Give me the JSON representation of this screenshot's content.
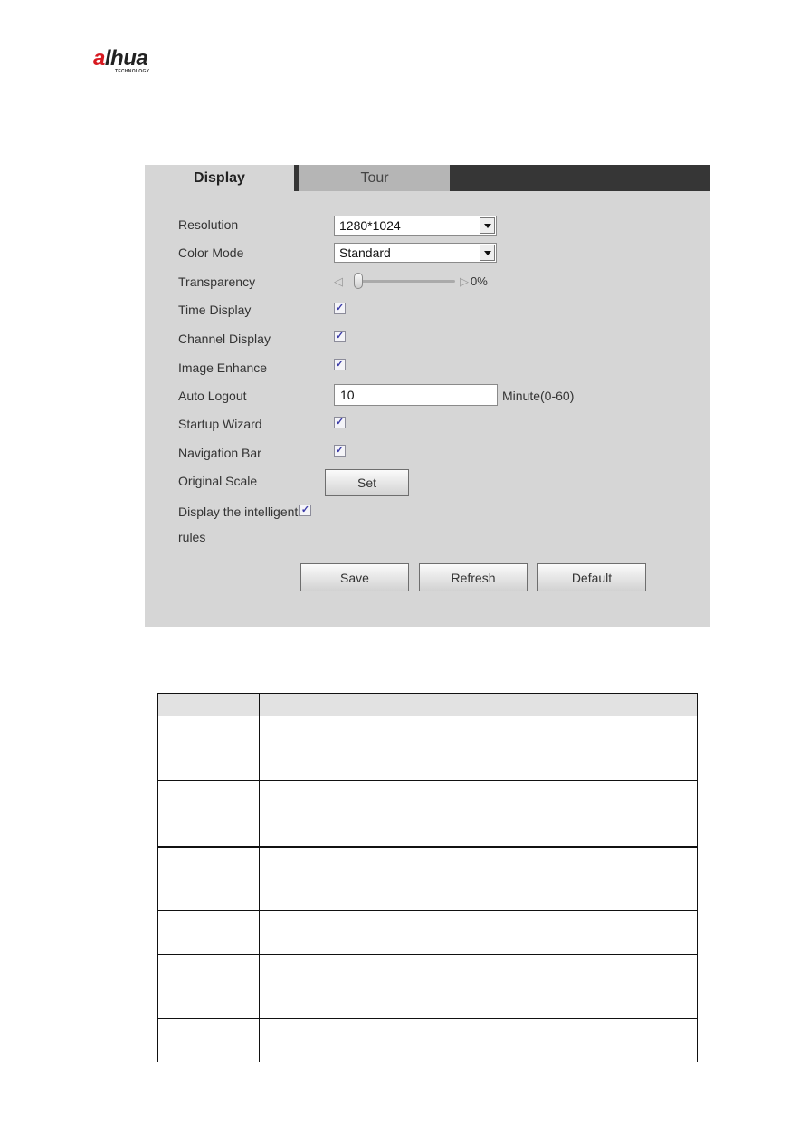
{
  "logo": {
    "a": "a",
    "rest": "lhua",
    "tagline": "TECHNOLOGY"
  },
  "tabs": [
    {
      "label": "Display",
      "active": true
    },
    {
      "label": "Tour",
      "active": false
    }
  ],
  "form": {
    "resolution": {
      "label": "Resolution",
      "value": "1280*1024"
    },
    "color_mode": {
      "label": "Color Mode",
      "value": "Standard"
    },
    "transparency": {
      "label": "Transparency",
      "left_symbol": "◁",
      "right_symbol": "▷",
      "value_text": "0%",
      "value_percent": 0
    },
    "time_display": {
      "label": "Time Display",
      "checked": true
    },
    "channel_display": {
      "label": "Channel Display",
      "checked": true
    },
    "image_enhance": {
      "label": "Image Enhance",
      "checked": true
    },
    "auto_logout": {
      "label": "Auto Logout",
      "value": "10",
      "unit": "Minute(0-60)"
    },
    "startup_wizard": {
      "label": "Startup Wizard",
      "checked": true
    },
    "navigation_bar": {
      "label": "Navigation Bar",
      "checked": true
    },
    "original_scale": {
      "label": "Original Scale",
      "button": "Set"
    },
    "intelligent_rules": {
      "label_line1": "Display the intelligent",
      "label_line2": "rules",
      "checked": true
    },
    "checkmark": "✓"
  },
  "buttons": {
    "save": "Save",
    "refresh": "Refresh",
    "default": "Default"
  },
  "table": {
    "header": [
      "",
      ""
    ],
    "rows": [
      [
        "",
        ""
      ],
      [
        "",
        ""
      ],
      [
        "",
        ""
      ],
      [
        "",
        ""
      ],
      [
        "",
        ""
      ],
      [
        "",
        ""
      ],
      [
        "",
        ""
      ]
    ]
  }
}
